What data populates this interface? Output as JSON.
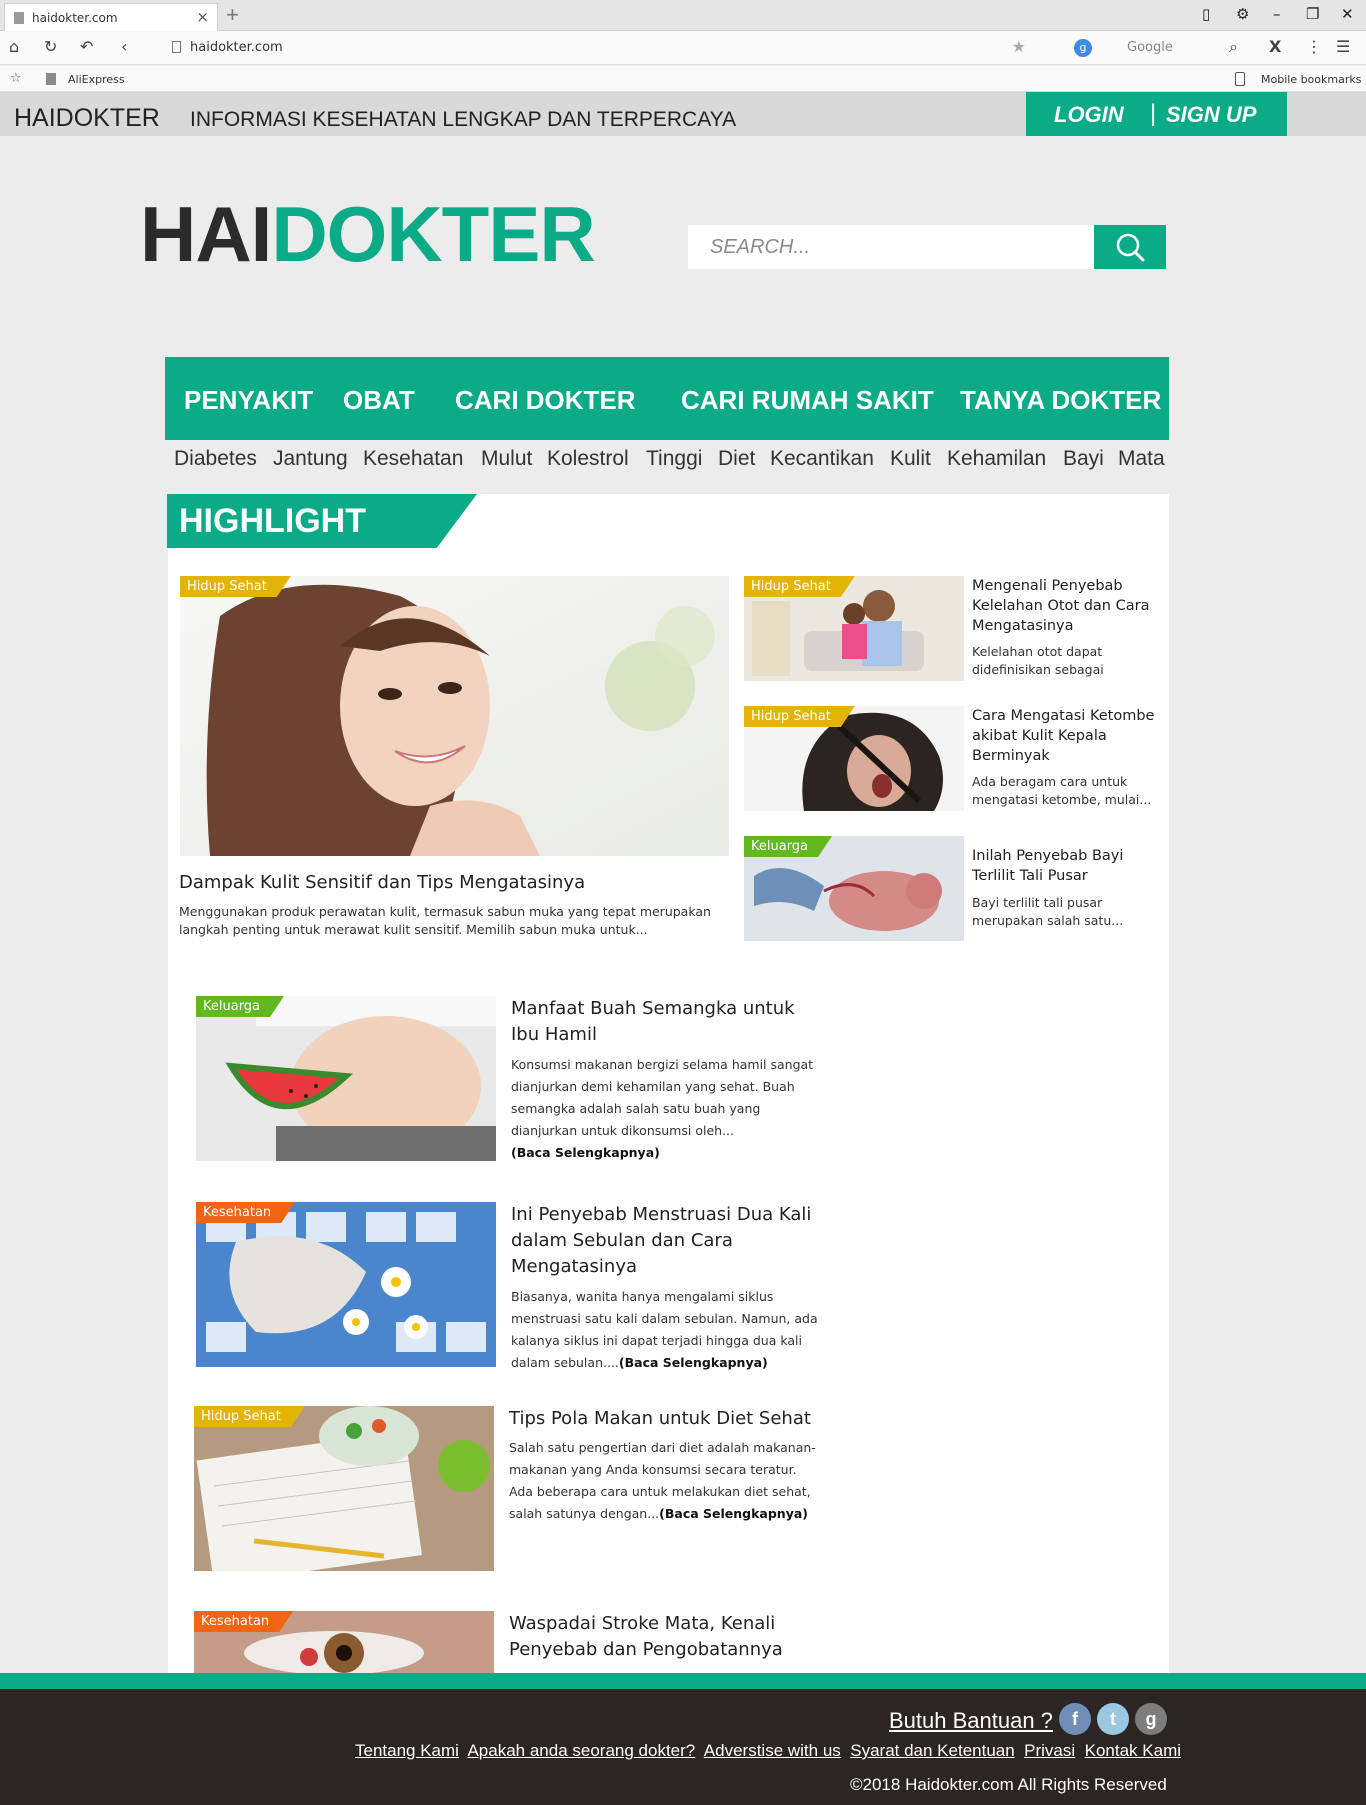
{
  "browser": {
    "tab_title": "haidokter.com",
    "url": "haidokter.com",
    "search_engine": "Google",
    "bookmarks": [
      "AliExpress"
    ],
    "mobile_bookmarks": "Mobile bookmarks"
  },
  "topbar": {
    "brand": "HAIDOKTER",
    "tagline": "INFORMASI KESEHATAN LENGKAP DAN TERPERCAYA",
    "login": "LOGIN",
    "divider": "|",
    "signup": "SIGN UP"
  },
  "logo": {
    "part1": "HAI",
    "part2": "DOKTER"
  },
  "search": {
    "placeholder": "SEARCH..."
  },
  "nav": [
    "PENYAKIT",
    "OBAT",
    "CARI DOKTER",
    "CARI RUMAH SAKIT",
    "TANYA DOKTER"
  ],
  "tags": [
    "Diabetes",
    "Jantung",
    "Kesehatan",
    "Mulut",
    "Kolestrol",
    "Tinggi",
    "Diet",
    "Kecantikan",
    "Kulit",
    "Kehamilan",
    "Bayi",
    "Mata"
  ],
  "highlight": {
    "heading": "HIGHLIGHT",
    "main": {
      "category": "Hidup Sehat",
      "title": "Dampak Kulit Sensitif dan Tips Mengatasinya",
      "desc_line1": "Menggunakan produk perawatan kulit, termasuk sabun muka yang tepat merupakan",
      "desc_line2": "langkah penting untuk merawat kulit sensitif. Memilih sabun muka untuk..."
    },
    "side": [
      {
        "category": "Hidup Sehat",
        "title": "Mengenali Penyebab Kelelahan Otot dan Cara Mengatasinya",
        "desc": "Kelelahan otot dapat didefinisikan sebagai"
      },
      {
        "category": "Hidup Sehat",
        "title": "Cara Mengatasi Ketombe akibat Kulit Kepala Berminyak",
        "desc": "Ada beragam cara untuk mengatasi ketombe, mulai..."
      },
      {
        "category": "Keluarga",
        "title": "Inilah Penyebab Bayi Terlilit Tali Pusar",
        "desc": "Bayi terlilit tali pusar merupakan salah satu..."
      }
    ]
  },
  "articles": [
    {
      "category": "Keluarga",
      "title": "Manfaat Buah Semangka untuk Ibu Hamil",
      "desc": "Konsumsi makanan bergizi selama hamil sangat dianjurkan demi kehamilan yang sehat. Buah semangka adalah salah satu buah yang dianjurkan untuk dikonsumsi oleh...",
      "read_more": "(Baca Selengkapnya)"
    },
    {
      "category": "Kesehatan",
      "title": "Ini Penyebab Menstruasi Dua Kali dalam Sebulan dan Cara Mengatasinya",
      "desc": "Biasanya, wanita hanya mengalami siklus menstruasi satu kali dalam sebulan. Namun, ada kalanya siklus ini dapat terjadi hingga dua kali dalam sebulan....",
      "read_more": "(Baca Selengkapnya)"
    },
    {
      "category": "Hidup Sehat",
      "title": "Tips Pola Makan untuk Diet Sehat",
      "desc": "Salah satu pengertian dari diet adalah makanan-makanan yang Anda konsumsi secara teratur. Ada beberapa cara untuk melakukan diet sehat, salah satunya dengan...",
      "read_more": "(Baca Selengkapnya)"
    },
    {
      "category": "Kesehatan",
      "title": "Waspadai Stroke Mata, Kenali Penyebab dan Pengobatannya",
      "desc": "",
      "read_more": ""
    }
  ],
  "footer": {
    "help": "Butuh Bantuan ?",
    "social": [
      "f",
      "t",
      "g"
    ],
    "links": [
      "Tentang Kami",
      "Apakah anda seorang dokter?",
      "Adverstise with us",
      "Syarat dan Ketentuan",
      "Privasi",
      "Kontak Kami"
    ],
    "copyright": "©2018 Haidokter.com All Rights Reserved"
  },
  "colors": {
    "brand": "#0aab86",
    "dark": "#2d2424",
    "cat_yellow": "#e3b406",
    "cat_green": "#63b81f",
    "cat_orange": "#f06414"
  },
  "icons": [
    "home-icon",
    "reload-icon",
    "undo-icon",
    "back-icon",
    "bookmark-star-icon",
    "search-icon",
    "menu-icon",
    "facebook-icon",
    "twitter-icon",
    "google-icon"
  ]
}
